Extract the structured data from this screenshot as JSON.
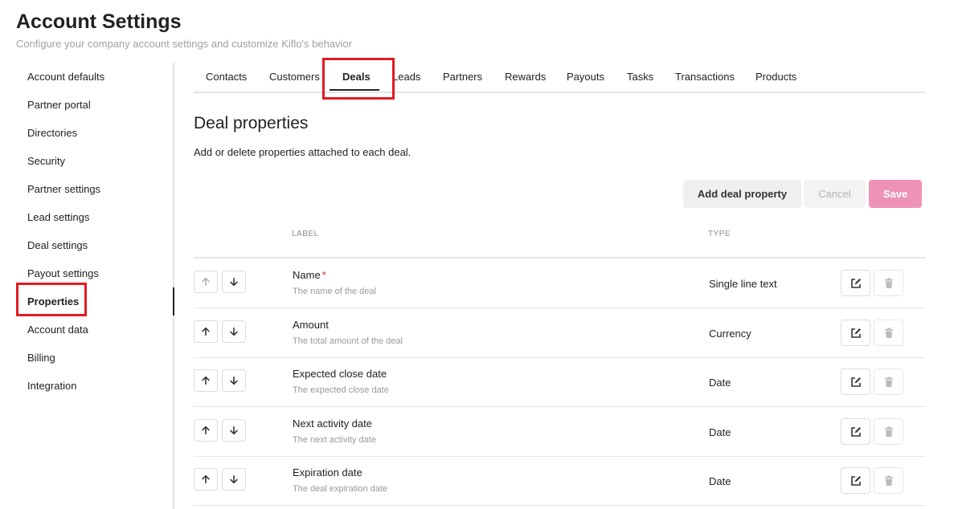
{
  "header": {
    "title": "Account Settings",
    "subtitle": "Configure your company account settings and customize Kiflo's behavior"
  },
  "sidebar": {
    "items": [
      {
        "label": "Account defaults"
      },
      {
        "label": "Partner portal"
      },
      {
        "label": "Directories"
      },
      {
        "label": "Security"
      },
      {
        "label": "Partner settings"
      },
      {
        "label": "Lead settings"
      },
      {
        "label": "Deal settings"
      },
      {
        "label": "Payout settings"
      },
      {
        "label": "Properties"
      },
      {
        "label": "Account data"
      },
      {
        "label": "Billing"
      },
      {
        "label": "Integration"
      }
    ],
    "active": "Properties"
  },
  "tabs": [
    {
      "label": "Contacts"
    },
    {
      "label": "Customers"
    },
    {
      "label": "Deals"
    },
    {
      "label": "Leads"
    },
    {
      "label": "Partners"
    },
    {
      "label": "Rewards"
    },
    {
      "label": "Payouts"
    },
    {
      "label": "Tasks"
    },
    {
      "label": "Transactions"
    },
    {
      "label": "Products"
    }
  ],
  "active_tab": "Deals",
  "section": {
    "title": "Deal properties",
    "description": "Add or delete properties attached to each deal."
  },
  "actions": {
    "add_label": "Add deal property",
    "cancel_label": "Cancel",
    "save_label": "Save"
  },
  "table": {
    "columns": {
      "label": "LABEL",
      "type": "TYPE"
    },
    "rows": [
      {
        "label": "Name",
        "required": "*",
        "description": "The name of the deal",
        "type": "Single line text"
      },
      {
        "label": "Amount",
        "required": "",
        "description": "The total amount of the deal",
        "type": "Currency"
      },
      {
        "label": "Expected close date",
        "required": "",
        "description": "The expected close date",
        "type": "Date"
      },
      {
        "label": "Next activity date",
        "required": "",
        "description": "The next activity date",
        "type": "Date"
      },
      {
        "label": "Expiration date",
        "required": "",
        "description": "The deal expiration date",
        "type": "Date"
      }
    ]
  },
  "colors": {
    "highlight_box": "#e11b22",
    "save_button": "#ef92b7",
    "required_marker": "#d32f2f"
  },
  "icons": {
    "move_up": "arrow-up-icon",
    "move_down": "arrow-down-icon",
    "edit": "edit-icon",
    "delete": "trash-icon"
  }
}
